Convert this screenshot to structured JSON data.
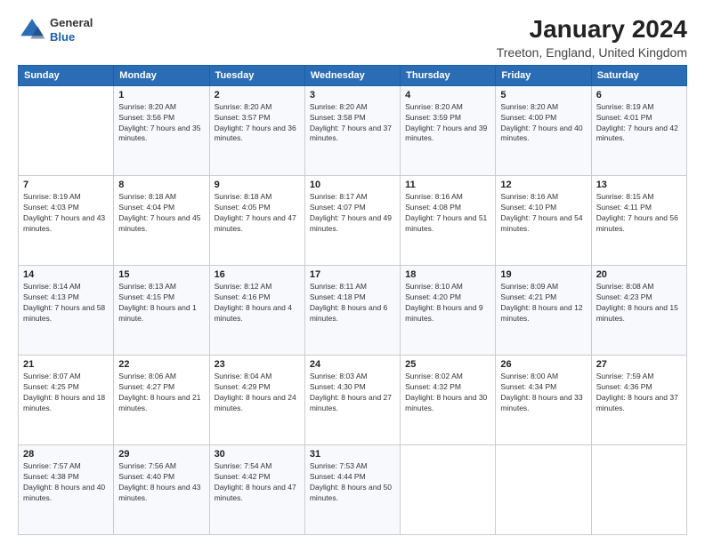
{
  "header": {
    "logo_general": "General",
    "logo_blue": "Blue",
    "month_title": "January 2024",
    "location": "Treeton, England, United Kingdom"
  },
  "days_of_week": [
    "Sunday",
    "Monday",
    "Tuesday",
    "Wednesday",
    "Thursday",
    "Friday",
    "Saturday"
  ],
  "weeks": [
    [
      {
        "day": "",
        "sunrise": "",
        "sunset": "",
        "daylight": ""
      },
      {
        "day": "1",
        "sunrise": "Sunrise: 8:20 AM",
        "sunset": "Sunset: 3:56 PM",
        "daylight": "Daylight: 7 hours and 35 minutes."
      },
      {
        "day": "2",
        "sunrise": "Sunrise: 8:20 AM",
        "sunset": "Sunset: 3:57 PM",
        "daylight": "Daylight: 7 hours and 36 minutes."
      },
      {
        "day": "3",
        "sunrise": "Sunrise: 8:20 AM",
        "sunset": "Sunset: 3:58 PM",
        "daylight": "Daylight: 7 hours and 37 minutes."
      },
      {
        "day": "4",
        "sunrise": "Sunrise: 8:20 AM",
        "sunset": "Sunset: 3:59 PM",
        "daylight": "Daylight: 7 hours and 39 minutes."
      },
      {
        "day": "5",
        "sunrise": "Sunrise: 8:20 AM",
        "sunset": "Sunset: 4:00 PM",
        "daylight": "Daylight: 7 hours and 40 minutes."
      },
      {
        "day": "6",
        "sunrise": "Sunrise: 8:19 AM",
        "sunset": "Sunset: 4:01 PM",
        "daylight": "Daylight: 7 hours and 42 minutes."
      }
    ],
    [
      {
        "day": "7",
        "sunrise": "Sunrise: 8:19 AM",
        "sunset": "Sunset: 4:03 PM",
        "daylight": "Daylight: 7 hours and 43 minutes."
      },
      {
        "day": "8",
        "sunrise": "Sunrise: 8:18 AM",
        "sunset": "Sunset: 4:04 PM",
        "daylight": "Daylight: 7 hours and 45 minutes."
      },
      {
        "day": "9",
        "sunrise": "Sunrise: 8:18 AM",
        "sunset": "Sunset: 4:05 PM",
        "daylight": "Daylight: 7 hours and 47 minutes."
      },
      {
        "day": "10",
        "sunrise": "Sunrise: 8:17 AM",
        "sunset": "Sunset: 4:07 PM",
        "daylight": "Daylight: 7 hours and 49 minutes."
      },
      {
        "day": "11",
        "sunrise": "Sunrise: 8:16 AM",
        "sunset": "Sunset: 4:08 PM",
        "daylight": "Daylight: 7 hours and 51 minutes."
      },
      {
        "day": "12",
        "sunrise": "Sunrise: 8:16 AM",
        "sunset": "Sunset: 4:10 PM",
        "daylight": "Daylight: 7 hours and 54 minutes."
      },
      {
        "day": "13",
        "sunrise": "Sunrise: 8:15 AM",
        "sunset": "Sunset: 4:11 PM",
        "daylight": "Daylight: 7 hours and 56 minutes."
      }
    ],
    [
      {
        "day": "14",
        "sunrise": "Sunrise: 8:14 AM",
        "sunset": "Sunset: 4:13 PM",
        "daylight": "Daylight: 7 hours and 58 minutes."
      },
      {
        "day": "15",
        "sunrise": "Sunrise: 8:13 AM",
        "sunset": "Sunset: 4:15 PM",
        "daylight": "Daylight: 8 hours and 1 minute."
      },
      {
        "day": "16",
        "sunrise": "Sunrise: 8:12 AM",
        "sunset": "Sunset: 4:16 PM",
        "daylight": "Daylight: 8 hours and 4 minutes."
      },
      {
        "day": "17",
        "sunrise": "Sunrise: 8:11 AM",
        "sunset": "Sunset: 4:18 PM",
        "daylight": "Daylight: 8 hours and 6 minutes."
      },
      {
        "day": "18",
        "sunrise": "Sunrise: 8:10 AM",
        "sunset": "Sunset: 4:20 PM",
        "daylight": "Daylight: 8 hours and 9 minutes."
      },
      {
        "day": "19",
        "sunrise": "Sunrise: 8:09 AM",
        "sunset": "Sunset: 4:21 PM",
        "daylight": "Daylight: 8 hours and 12 minutes."
      },
      {
        "day": "20",
        "sunrise": "Sunrise: 8:08 AM",
        "sunset": "Sunset: 4:23 PM",
        "daylight": "Daylight: 8 hours and 15 minutes."
      }
    ],
    [
      {
        "day": "21",
        "sunrise": "Sunrise: 8:07 AM",
        "sunset": "Sunset: 4:25 PM",
        "daylight": "Daylight: 8 hours and 18 minutes."
      },
      {
        "day": "22",
        "sunrise": "Sunrise: 8:06 AM",
        "sunset": "Sunset: 4:27 PM",
        "daylight": "Daylight: 8 hours and 21 minutes."
      },
      {
        "day": "23",
        "sunrise": "Sunrise: 8:04 AM",
        "sunset": "Sunset: 4:29 PM",
        "daylight": "Daylight: 8 hours and 24 minutes."
      },
      {
        "day": "24",
        "sunrise": "Sunrise: 8:03 AM",
        "sunset": "Sunset: 4:30 PM",
        "daylight": "Daylight: 8 hours and 27 minutes."
      },
      {
        "day": "25",
        "sunrise": "Sunrise: 8:02 AM",
        "sunset": "Sunset: 4:32 PM",
        "daylight": "Daylight: 8 hours and 30 minutes."
      },
      {
        "day": "26",
        "sunrise": "Sunrise: 8:00 AM",
        "sunset": "Sunset: 4:34 PM",
        "daylight": "Daylight: 8 hours and 33 minutes."
      },
      {
        "day": "27",
        "sunrise": "Sunrise: 7:59 AM",
        "sunset": "Sunset: 4:36 PM",
        "daylight": "Daylight: 8 hours and 37 minutes."
      }
    ],
    [
      {
        "day": "28",
        "sunrise": "Sunrise: 7:57 AM",
        "sunset": "Sunset: 4:38 PM",
        "daylight": "Daylight: 8 hours and 40 minutes."
      },
      {
        "day": "29",
        "sunrise": "Sunrise: 7:56 AM",
        "sunset": "Sunset: 4:40 PM",
        "daylight": "Daylight: 8 hours and 43 minutes."
      },
      {
        "day": "30",
        "sunrise": "Sunrise: 7:54 AM",
        "sunset": "Sunset: 4:42 PM",
        "daylight": "Daylight: 8 hours and 47 minutes."
      },
      {
        "day": "31",
        "sunrise": "Sunrise: 7:53 AM",
        "sunset": "Sunset: 4:44 PM",
        "daylight": "Daylight: 8 hours and 50 minutes."
      },
      {
        "day": "",
        "sunrise": "",
        "sunset": "",
        "daylight": ""
      },
      {
        "day": "",
        "sunrise": "",
        "sunset": "",
        "daylight": ""
      },
      {
        "day": "",
        "sunrise": "",
        "sunset": "",
        "daylight": ""
      }
    ]
  ]
}
